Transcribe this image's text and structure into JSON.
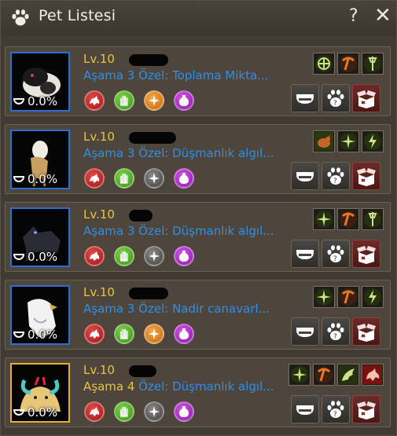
{
  "window": {
    "title": "Pet Listesi",
    "help": "?",
    "close": "✕"
  },
  "pets": [
    {
      "level": "Lv.10",
      "stage": "Aşama 3",
      "special": "Özel: Toplama Mikta...",
      "hunger": "0.0%",
      "frame": "blue",
      "stat_icons": [
        "red-beast-icon",
        "green-hand-icon",
        "orange-compass-icon",
        "purple-potion-icon"
      ],
      "skill_icons": [
        "gather-compass-skill-icon",
        "pickaxe-skill-icon",
        "axe-skill-icon"
      ]
    },
    {
      "level": "Lv.10",
      "stage": "Aşama 3",
      "special": "Özel: Düşmanlık algıl...",
      "hunger": "0.0%",
      "frame": "blue",
      "stat_icons": [
        "red-beast-icon",
        "green-hand-icon",
        "gray-compass-icon",
        "purple-potion-icon"
      ],
      "skill_icons": [
        "chicken-skill-icon",
        "target-compass-skill-icon",
        "lightning-skill-icon"
      ]
    },
    {
      "level": "Lv.10",
      "stage": "Aşama 3",
      "special": "Özel: Düşmanlık algıl...",
      "hunger": "0.0%",
      "frame": "blue",
      "stat_icons": [
        "red-beast-icon",
        "green-hand-icon",
        "gray-compass-icon",
        "purple-potion-icon"
      ],
      "skill_icons": [
        "target-compass-skill-icon",
        "pickaxe-skill-icon",
        "axe-skill-icon"
      ]
    },
    {
      "level": "Lv.10",
      "stage": "Aşama 3",
      "special": "Özel: Nadir canavarl...",
      "hunger": "0.0%",
      "frame": "blue",
      "stat_icons": [
        "red-beast-icon",
        "green-hand-icon",
        "orange-compass-icon",
        "purple-potion-icon"
      ],
      "skill_icons": [
        "target-compass-skill-icon",
        "pickaxe-skill-icon",
        "lightning-skill-icon"
      ]
    },
    {
      "level": "Lv.10",
      "stage": "Aşama 4",
      "special": "Özel: Düşmanlık algıl...",
      "hunger": "0.0%",
      "frame": "gold",
      "stat_icons": [
        "red-beast-icon",
        "green-hand-icon",
        "gray-compass-icon",
        "purple-potion-icon"
      ],
      "skill_icons": [
        "target-compass-skill-icon",
        "pickaxe-skill-icon",
        "wing-skill-icon",
        "red-beast-skill-icon"
      ]
    }
  ],
  "actions": [
    "feed-bowl-button",
    "pet-info-button",
    "release-box-button"
  ]
}
